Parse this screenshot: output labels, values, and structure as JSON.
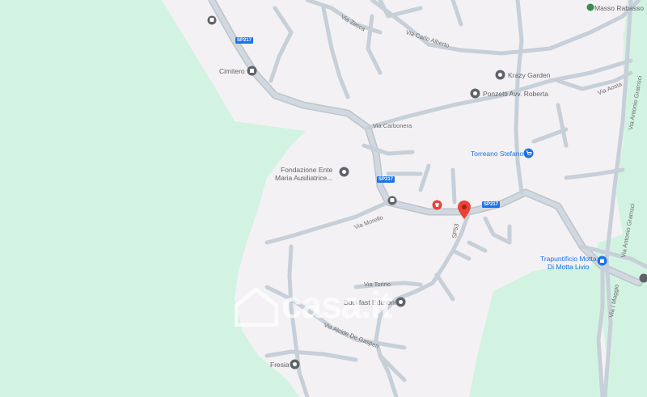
{
  "colors": {
    "background": "#f4f1f4",
    "green": "#d3f3e2",
    "road": "#c7cfd8",
    "road_main": "#bcc4ce",
    "pin": "#ea4335",
    "poi_icon": "#5f6368",
    "shop_icon": "#1a73e8"
  },
  "places": {
    "masso_rabasso": "Masso Rabasso",
    "cimitero": "Cimitero",
    "krazy_garden": "Krazy Garden",
    "ponzetti": "Ponzetti Avv. Roberta",
    "torreano": "Torreano Stefano",
    "fondazione": "Fondazione Ente\nMaria Ausiliatrice...",
    "trapuntificio": "Trapuntificio Motta\nDi Motta Livio",
    "buckfast": "Buckfast Edizioni",
    "fresia": "Fresia"
  },
  "roads": {
    "via_zecca": "Via Zecca",
    "via_carlo_alberto": "Via Carlo Alberto",
    "via_aosta": "Via Aosta",
    "via_antonio_gramsci": "Via Antonio Gramsci",
    "via_carbonera": "Via Carbonera",
    "via_morello": "Via Morello",
    "via_torino": "Via Torino",
    "via_alcide": "Via Alcide De Gasperi",
    "via_maggio": "Via I Maggio",
    "sp217": "SP217",
    "sp53": "SP53"
  },
  "watermark": "casa.it"
}
